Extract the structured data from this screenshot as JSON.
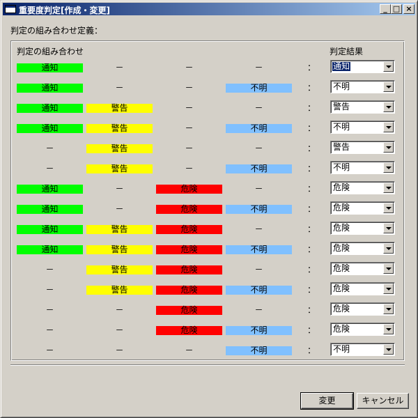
{
  "window": {
    "title": "重要度判定[作成・変更]",
    "min_glyph": "_",
    "max_glyph": "□",
    "close_glyph": "×"
  },
  "section_label": "判定の組み合わせ定義：",
  "headers": {
    "combination": "判定の組み合わせ",
    "result": "判定結果"
  },
  "colors": {
    "notice": "#00ff00",
    "warning": "#ffff00",
    "danger": "#ff0000",
    "unknown": "#80c0ff"
  },
  "colon": "：",
  "rows": [
    {
      "c1": "通知",
      "c2": "－",
      "c3": "－",
      "c4": "－",
      "result": "通知"
    },
    {
      "c1": "通知",
      "c2": "－",
      "c3": "－",
      "c4": "不明",
      "result": "不明"
    },
    {
      "c1": "通知",
      "c2": "警告",
      "c3": "－",
      "c4": "－",
      "result": "警告"
    },
    {
      "c1": "通知",
      "c2": "警告",
      "c3": "－",
      "c4": "不明",
      "result": "不明"
    },
    {
      "c1": "－",
      "c2": "警告",
      "c3": "－",
      "c4": "－",
      "result": "警告"
    },
    {
      "c1": "－",
      "c2": "警告",
      "c3": "－",
      "c4": "不明",
      "result": "不明"
    },
    {
      "c1": "通知",
      "c2": "－",
      "c3": "危険",
      "c4": "－",
      "result": "危険"
    },
    {
      "c1": "通知",
      "c2": "－",
      "c3": "危険",
      "c4": "不明",
      "result": "危険"
    },
    {
      "c1": "通知",
      "c2": "警告",
      "c3": "危険",
      "c4": "－",
      "result": "危険"
    },
    {
      "c1": "通知",
      "c2": "警告",
      "c3": "危険",
      "c4": "不明",
      "result": "危険"
    },
    {
      "c1": "－",
      "c2": "警告",
      "c3": "危険",
      "c4": "－",
      "result": "危険"
    },
    {
      "c1": "－",
      "c2": "警告",
      "c3": "危険",
      "c4": "不明",
      "result": "危険"
    },
    {
      "c1": "－",
      "c2": "－",
      "c3": "危険",
      "c4": "－",
      "result": "危険"
    },
    {
      "c1": "－",
      "c2": "－",
      "c3": "危険",
      "c4": "不明",
      "result": "危険"
    },
    {
      "c1": "－",
      "c2": "－",
      "c3": "－",
      "c4": "不明",
      "result": "不明"
    }
  ],
  "buttons": {
    "change": "変更",
    "cancel": "キャンセル"
  }
}
